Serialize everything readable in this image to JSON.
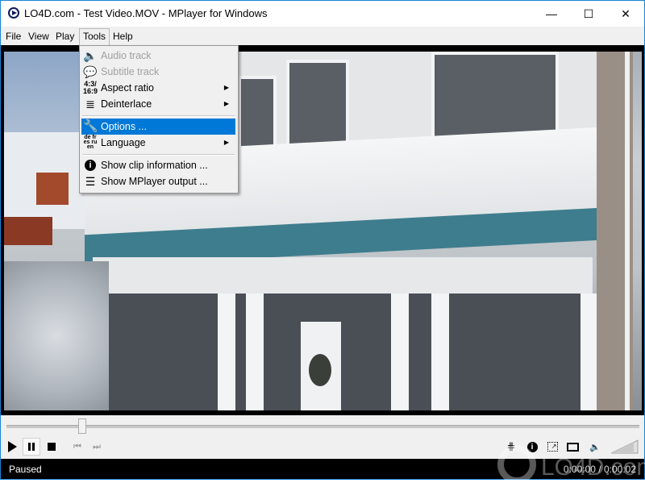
{
  "window": {
    "title": "LO4D.com - Test Video.MOV - MPlayer for Windows",
    "icon": "play-circle-icon",
    "controls": {
      "minimize": "—",
      "maximize": "☐",
      "close": "✕"
    }
  },
  "menubar": {
    "items": [
      {
        "label": "File"
      },
      {
        "label": "View"
      },
      {
        "label": "Play"
      },
      {
        "label": "Tools",
        "open": true
      },
      {
        "label": "Help"
      }
    ]
  },
  "tools_menu": {
    "items": [
      {
        "label": "Audio track",
        "icon": "speaker-icon",
        "disabled": true
      },
      {
        "label": "Subtitle track",
        "icon": "speech-bubble-icon",
        "disabled": true
      },
      {
        "label": "Aspect ratio",
        "icon": "aspect-ratio-icon",
        "icon_text": "4:3/ 16:9",
        "submenu": true
      },
      {
        "label": "Deinterlace",
        "icon": "deinterlace-icon",
        "submenu": true
      },
      {
        "label": "Options ...",
        "icon": "wrench-icon",
        "highlighted": true
      },
      {
        "label": "Language",
        "icon": "language-icon",
        "icon_text": "de fr es ru en",
        "submenu": true
      },
      {
        "label": "Show clip information ...",
        "icon": "info-icon"
      },
      {
        "label": "Show MPlayer output ...",
        "icon": "output-log-icon"
      }
    ],
    "submenu_arrow": "▶"
  },
  "playback": {
    "seek_position_fraction": 0.12,
    "buttons": [
      {
        "name": "play",
        "icon": "play-icon"
      },
      {
        "name": "pause",
        "icon": "pause-icon",
        "pressed": true
      },
      {
        "name": "stop",
        "icon": "stop-icon"
      },
      {
        "name": "previous",
        "icon": "skip-back-icon",
        "disabled": true
      },
      {
        "name": "next",
        "icon": "skip-forward-icon",
        "disabled": true
      }
    ],
    "right_buttons": [
      {
        "name": "playlist",
        "icon": "playlist-icon"
      },
      {
        "name": "clip-info",
        "icon": "info-icon"
      },
      {
        "name": "resize",
        "icon": "resize-icon"
      },
      {
        "name": "fullscreen",
        "icon": "fullscreen-icon"
      },
      {
        "name": "mute",
        "icon": "speaker-icon"
      }
    ],
    "volume_fraction": 0.85
  },
  "status": {
    "state": "Paused",
    "time": "0:00:00 / 0:00:02"
  },
  "watermark": {
    "text": "LO4D.com"
  },
  "colors": {
    "highlight": "#0078d7",
    "window_border": "#1883d7",
    "statusbar_bg": "#000000"
  }
}
